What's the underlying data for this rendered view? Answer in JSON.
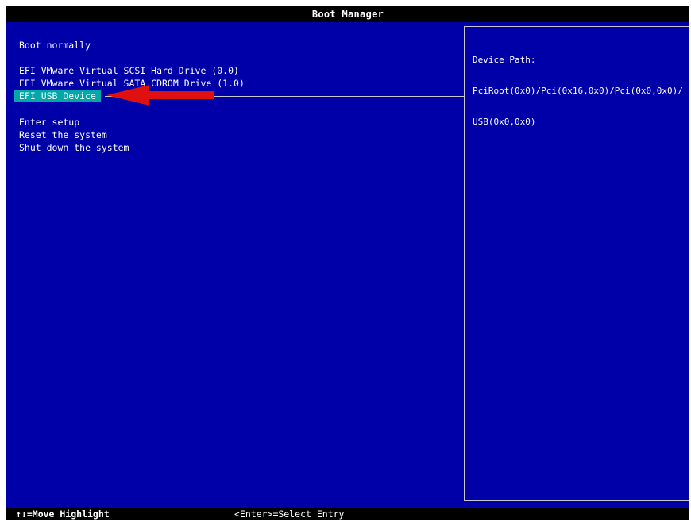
{
  "window": {
    "title": "Boot Manager"
  },
  "menu": {
    "items": [
      {
        "label": "Boot normally",
        "selected": false
      },
      {
        "label": "EFI VMware Virtual SCSI Hard Drive (0.0)",
        "selected": false
      },
      {
        "label": "EFI VMware Virtual SATA CDROM Drive (1.0)",
        "selected": false
      },
      {
        "label": "EFI USB Device",
        "selected": true
      },
      {
        "label": "Enter setup",
        "selected": false
      },
      {
        "label": "Reset the system",
        "selected": false
      },
      {
        "label": "Shut down the system",
        "selected": false
      }
    ]
  },
  "info_panel": {
    "heading": "Device Path:",
    "path_line1": "PciRoot(0x0)/Pci(0x16,0x0)/Pci(0x0,0x0)/",
    "path_line2": "USB(0x0,0x0)"
  },
  "footer": {
    "move_hint": "↑↓=Move Highlight",
    "select_hint": "<Enter>=Select Entry"
  },
  "colors": {
    "background": "#0000a8",
    "highlight": "#00a8a8",
    "bars": "#000000",
    "text": "#ffffff",
    "annotation_arrow": "#e01010"
  },
  "annotation": {
    "icon": "red-arrow-pointing-left"
  }
}
